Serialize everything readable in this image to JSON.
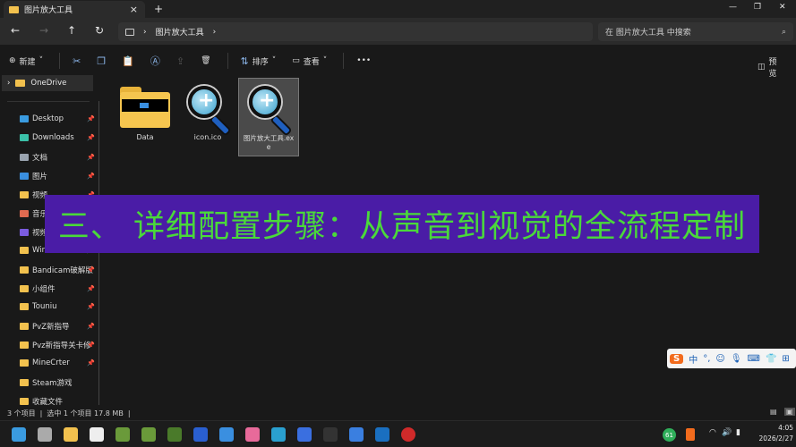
{
  "tab": {
    "title": "图片放大工具",
    "close": "×",
    "new": "+"
  },
  "window": {
    "minimize": "—",
    "maximize": "❐",
    "close": "✕"
  },
  "nav": {
    "back": "←",
    "forward": "→",
    "up": "↑",
    "refresh": "↻",
    "breadcrumb": [
      "图片放大工具"
    ],
    "search_placeholder": "在 图片放大工具 中搜索"
  },
  "toolbar": {
    "new": "新建",
    "sort": "排序",
    "view": "查看",
    "more": "•••",
    "preview": "预览"
  },
  "sidebar": {
    "onedrive": "OneDrive",
    "items": [
      {
        "label": "Desktop",
        "icon": "desktop-icon",
        "color": "#3a9be0",
        "pinned": true
      },
      {
        "label": "Downloads",
        "icon": "download-icon",
        "color": "#3bc1a8",
        "pinned": true
      },
      {
        "label": "文档",
        "icon": "document-icon",
        "color": "#9aa4b0",
        "pinned": true
      },
      {
        "label": "图片",
        "icon": "picture-icon",
        "color": "#3a8fe0",
        "pinned": true
      },
      {
        "label": "视频",
        "icon": "folder-icon",
        "color": "#f2c14e",
        "pinned": true
      },
      {
        "label": "音乐",
        "icon": "music-icon",
        "color": "#e06a50",
        "pinned": true
      },
      {
        "label": "视频",
        "icon": "video-icon",
        "color": "#7b5ce0",
        "pinned": true
      },
      {
        "label": "Windows",
        "icon": "folder-icon",
        "color": "#f2c14e",
        "pinned": true
      },
      {
        "label": "Bandicam破解版",
        "icon": "folder-icon",
        "color": "#f2c14e",
        "pinned": true
      },
      {
        "label": "小组件",
        "icon": "folder-icon",
        "color": "#f2c14e",
        "pinned": true
      },
      {
        "label": "Touniu",
        "icon": "folder-icon",
        "color": "#f2c14e",
        "pinned": true
      },
      {
        "label": "PvZ新指导",
        "icon": "folder-icon",
        "color": "#f2c14e",
        "pinned": true
      },
      {
        "label": "Pvz新指导关卡修",
        "icon": "folder-icon",
        "color": "#f2c14e",
        "pinned": true
      },
      {
        "label": "MineCrter",
        "icon": "folder-icon",
        "color": "#f2c14e",
        "pinned": true
      },
      {
        "label": "Steam游戏",
        "icon": "folder-icon",
        "color": "#f2c14e",
        "pinned": false
      },
      {
        "label": "收藏文件",
        "icon": "folder-icon",
        "color": "#f2c14e",
        "pinned": false
      }
    ]
  },
  "files": [
    {
      "name": "Data",
      "type": "folder"
    },
    {
      "name": "icon.ico",
      "type": "icon"
    },
    {
      "name": "图片放大工具.exe",
      "type": "exe",
      "selected": true
    }
  ],
  "banner": {
    "text": "三、 详细配置步骤：从声音到视觉的全流程定制",
    "bg": "#4a1ca6",
    "color": "#4ad93a"
  },
  "status": {
    "count": "3 个项目",
    "selected": "选中 1 个项目  17.8 MB"
  },
  "ime": {
    "logo": "S",
    "mode": "中",
    "punct": "°,"
  },
  "taskbar": {
    "badge": "61",
    "time": "4:05",
    "date": "2026/2/27"
  }
}
